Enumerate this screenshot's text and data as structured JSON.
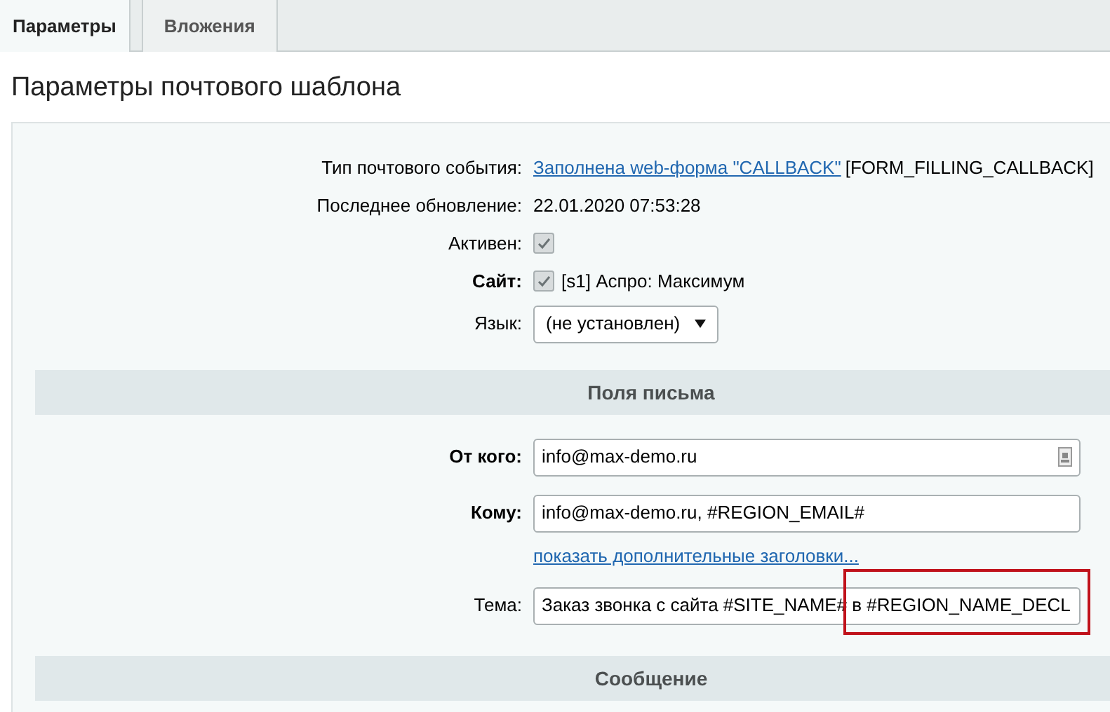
{
  "tabs": [
    {
      "label": "Параметры",
      "selected": true
    },
    {
      "label": "Вложения",
      "selected": false
    }
  ],
  "title": "Параметры почтового шаблона",
  "rows": [
    {
      "kind": "link",
      "label": "Тип почтового события:",
      "required": false,
      "link": "Заполнена web-форма \"CALLBACK\"",
      "value": "[FORM_FILLING_CALLBACK]"
    },
    {
      "kind": "text",
      "label": "Последнее обновление:",
      "required": false,
      "value": "22.01.2020 07:53:28"
    },
    {
      "kind": "checkbox",
      "label": "Активен:",
      "required": false,
      "checked": true
    },
    {
      "kind": "checkbox",
      "label": "Сайт:",
      "required": true,
      "checked": true,
      "value": "[s1] Аспро: Максимум"
    },
    {
      "kind": "select",
      "label": "Язык:",
      "required": false,
      "value": "(не установлен)"
    }
  ],
  "sections": [
    {
      "title": "Поля письма",
      "fields": [
        {
          "kind": "input",
          "label": "От кого:",
          "required": true,
          "value": "info@max-demo.ru",
          "picker": true,
          "highlighted": false
        },
        {
          "kind": "input",
          "label": "Кому:",
          "required": true,
          "value": "info@max-demo.ru, #REGION_EMAIL#",
          "picker": false,
          "highlighted": false
        },
        {
          "kind": "link",
          "link": "показать дополнительные заголовки..."
        },
        {
          "kind": "input",
          "label": "Тема:",
          "required": false,
          "value": "Заказ звонка с сайта #SITE_NAME# в #REGION_NAME_DECL",
          "picker": false,
          "highlighted": true
        }
      ]
    },
    {
      "title": "Сообщение"
    }
  ]
}
